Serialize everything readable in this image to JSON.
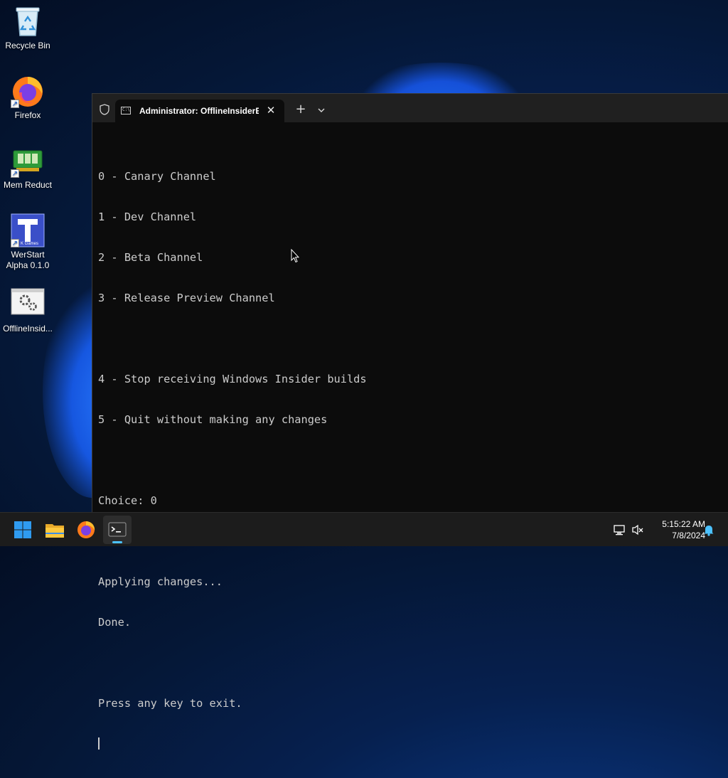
{
  "desktop": {
    "icons": [
      {
        "label": "Recycle Bin",
        "icon": "recycle-bin-icon"
      },
      {
        "label": "Firefox",
        "icon": "firefox-icon"
      },
      {
        "label": "Mem Reduct",
        "icon": "mem-reduct-icon"
      },
      {
        "label": "WerStart\nAlpha 0.1.0",
        "icon": "werstart-icon",
        "badge": "K Games"
      },
      {
        "label": "OfflineInsid...",
        "icon": "offlineinsider-icon"
      }
    ]
  },
  "terminal": {
    "tab_title": "Administrator:  OfflineInsiderE",
    "tab_icon": "cmd-icon",
    "tab_icon_text": "C:\\",
    "lines": [
      "0 - Canary Channel",
      "1 - Dev Channel",
      "2 - Beta Channel",
      "3 - Release Preview Channel",
      "",
      "4 - Stop receiving Windows Insider builds",
      "5 - Quit without making any changes",
      "",
      "Choice: 0",
      "",
      "Applying changes...",
      "Done.",
      "",
      "Press any key to exit."
    ]
  },
  "taskbar": {
    "apps": [
      "start-icon",
      "file-explorer-icon",
      "firefox-icon",
      "terminal-icon"
    ],
    "active_app": "terminal-icon",
    "clock": {
      "time": "5:15:22 AM",
      "date": "7/8/2024"
    },
    "tray": [
      "network-icon",
      "volume-muted-icon",
      "notification-bell-icon"
    ]
  },
  "colors": {
    "terminal_bg": "#0c0c0c",
    "terminal_fg": "#cccccc",
    "titlebar_bg": "#202020",
    "taskbar_bg": "#1c1c1c",
    "accent": "#4cc2ff"
  }
}
